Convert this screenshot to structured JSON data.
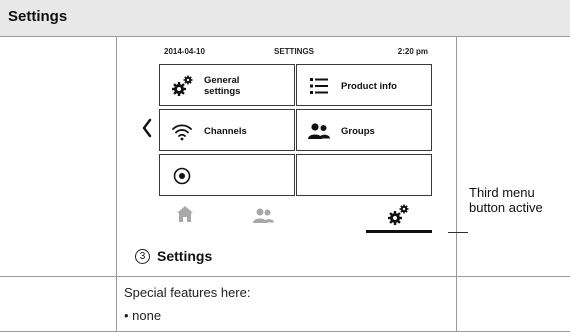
{
  "header": {
    "title": "Settings"
  },
  "device": {
    "status_date": "2014-04-10",
    "status_title": "SETTINGS",
    "status_time": "2:20 pm",
    "tiles": [
      {
        "label": "General\nsettings",
        "icon": "gears-icon"
      },
      {
        "label": "Product info",
        "icon": "list-icon"
      },
      {
        "label": "Channels",
        "icon": "wifi-icon"
      },
      {
        "label": "Groups",
        "icon": "people-icon"
      },
      {
        "label": "",
        "icon": "radio-target-icon"
      },
      {
        "label": "",
        "icon": ""
      }
    ],
    "nav": [
      "home-icon",
      "groups-icon",
      "settings-gears-icon"
    ],
    "active_nav": "settings-gears-icon"
  },
  "annotation": "Third menu\nbutton active",
  "section": {
    "number": "3",
    "label": "Settings"
  },
  "features": {
    "heading": "Special features here:",
    "items": [
      "• none"
    ]
  }
}
